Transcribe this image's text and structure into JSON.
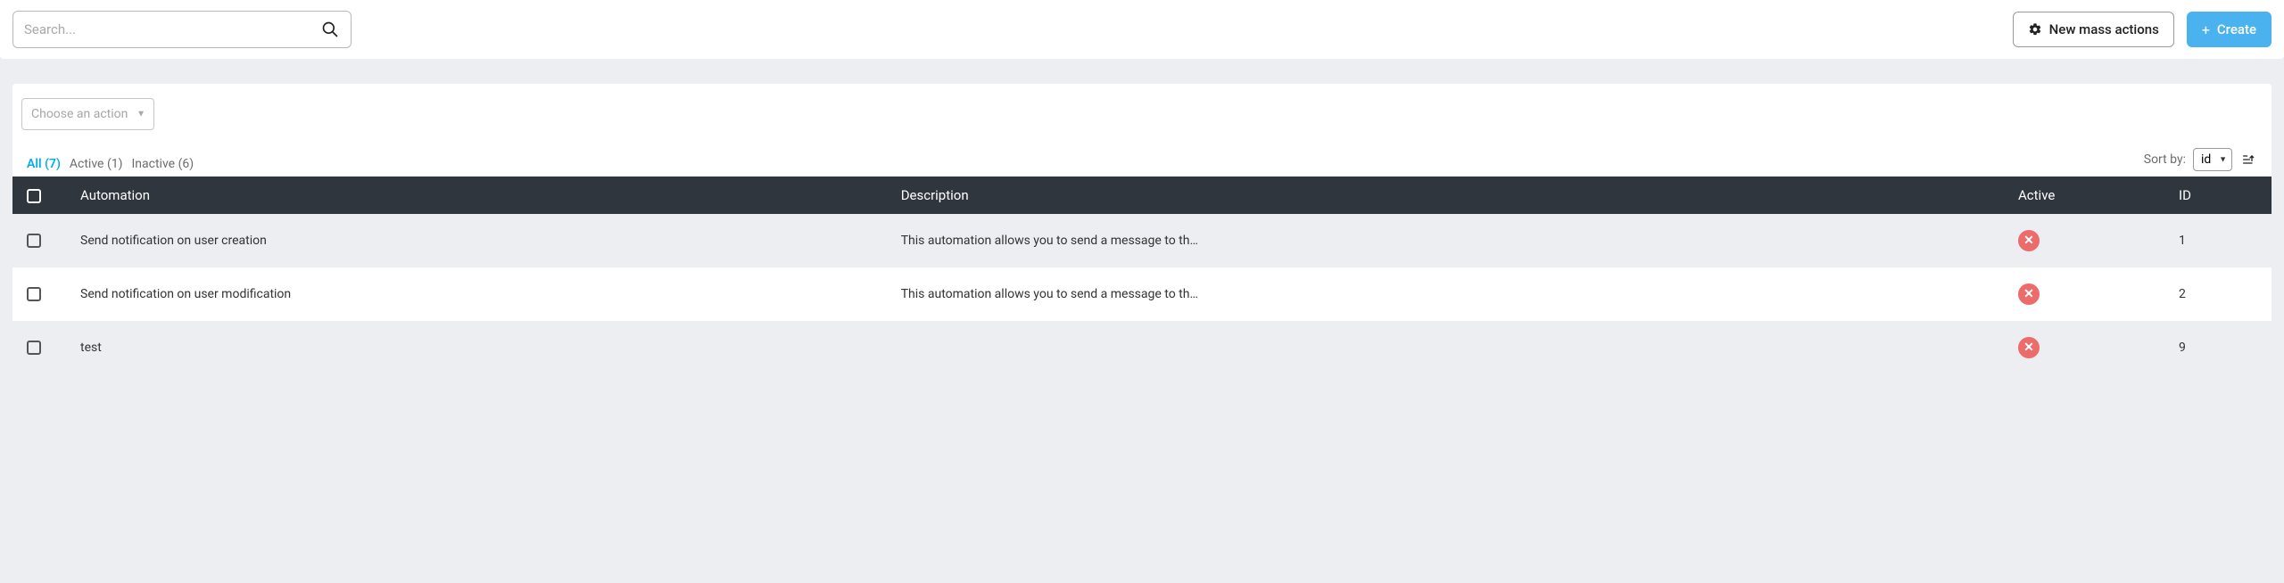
{
  "topbar": {
    "search_placeholder": "Search...",
    "mass_actions_label": "New mass actions",
    "create_label": "Create"
  },
  "bulk": {
    "select_placeholder": "Choose an action"
  },
  "filters": {
    "all": {
      "label": "All",
      "count": "(7)"
    },
    "active": {
      "label": "Active",
      "count": "(1)"
    },
    "inactive": {
      "label": "Inactive",
      "count": "(6)"
    }
  },
  "sort": {
    "label": "Sort by:",
    "selected": "id"
  },
  "columns": {
    "automation": "Automation",
    "description": "Description",
    "active": "Active",
    "id": "ID"
  },
  "rows": [
    {
      "automation": "Send notification on user creation",
      "description": "This automation allows you to send a message to th…",
      "active": false,
      "id": "1"
    },
    {
      "automation": "Send notification on user modification",
      "description": "This automation allows you to send a message to th…",
      "active": false,
      "id": "2"
    },
    {
      "automation": "test",
      "description": "",
      "active": false,
      "id": "9"
    }
  ]
}
